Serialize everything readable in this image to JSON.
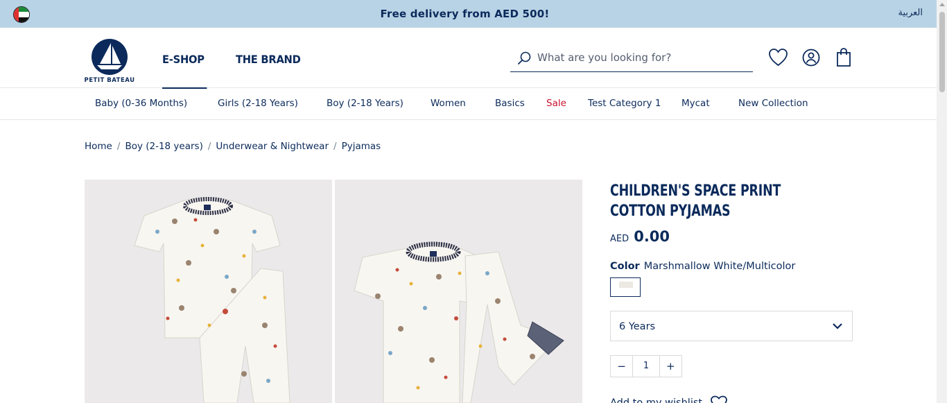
{
  "topbar": {
    "promo": "Free delivery from AED 500!",
    "language": "العربية",
    "flag_icon": "uae-flag-icon"
  },
  "header": {
    "logo_text": "PETIT BATEAU",
    "nav": [
      {
        "label": "E-SHOP",
        "active": true
      },
      {
        "label": "THE BRAND",
        "active": false
      }
    ],
    "search": {
      "placeholder": "What are you looking for?",
      "value": ""
    },
    "icons": [
      "search-icon",
      "heart-icon",
      "user-icon",
      "bag-icon"
    ]
  },
  "categories": [
    {
      "label": "Baby (0-36 Months)"
    },
    {
      "label": "Girls (2-18 Years)"
    },
    {
      "label": "Boy (2-18 Years)"
    },
    {
      "label": "Women"
    },
    {
      "label": "Basics"
    },
    {
      "label": "Sale",
      "highlight": "#c8102e"
    },
    {
      "label": "Test Category 1"
    },
    {
      "label": "Mycat"
    },
    {
      "label": "New Collection"
    }
  ],
  "breadcrumb": [
    {
      "label": "Home"
    },
    {
      "label": "Boy (2-18 years)"
    },
    {
      "label": "Underwear & Nightwear"
    },
    {
      "label": "Pyjamas"
    }
  ],
  "product": {
    "title": "CHILDREN'S SPACE PRINT COTTON PYJAMAS",
    "currency": "AED",
    "price": "0.00",
    "color_label": "Color",
    "color_value": "Marshmallow White/Multicolor",
    "size_selected": "6 Years",
    "quantity": "1",
    "qty_minus": "−",
    "qty_plus": "+",
    "wishlist_label": "Add to my wishlist"
  },
  "colors": {
    "navy": "#0b2a5b",
    "banner": "#b9d3e6",
    "sale": "#c8102e",
    "image_bg": "#ebe9ea"
  }
}
